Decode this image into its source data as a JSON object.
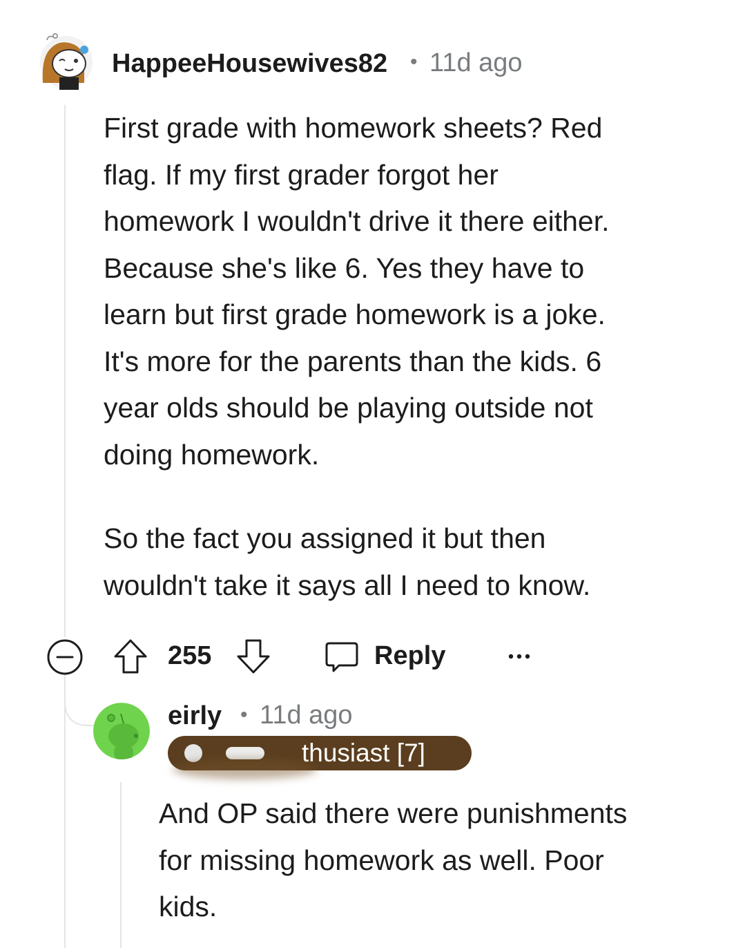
{
  "comments": [
    {
      "username": "HappeeHousewives82",
      "separator": "•",
      "time": "11d ago",
      "avatar_icon": "snoo-avatar-girl-icon",
      "body_paragraphs": [
        "First grade with homework sheets? Red\nflag. If my first grader forgot her\nhomework I wouldn't drive it there either.\nBecause she's like 6. Yes they have to\nlearn but first grade homework is a joke.\nIt's more for the parents than the kids. 6\nyear olds should be playing outside not\ndoing homework.",
        "So the fact you assigned it but then\nwouldn't take it says all I need to know."
      ],
      "score": "255",
      "reply_label": "Reply",
      "more_icon": "more-options-icon"
    },
    {
      "username": "eirly",
      "separator": "•",
      "time": "11d ago",
      "avatar_icon": "snoo-avatar-green-icon",
      "flair_text": "thusiast [7]",
      "flair_color": "#5a3e1f",
      "body_paragraphs": [
        "And OP said there were punishments\nfor missing homework as well. Poor\nkids."
      ]
    }
  ],
  "colors": {
    "text": "#1c1c1c",
    "meta": "#787c7e",
    "thread_line": "#e3e5e8",
    "avatar_green": "#6fd34e"
  }
}
